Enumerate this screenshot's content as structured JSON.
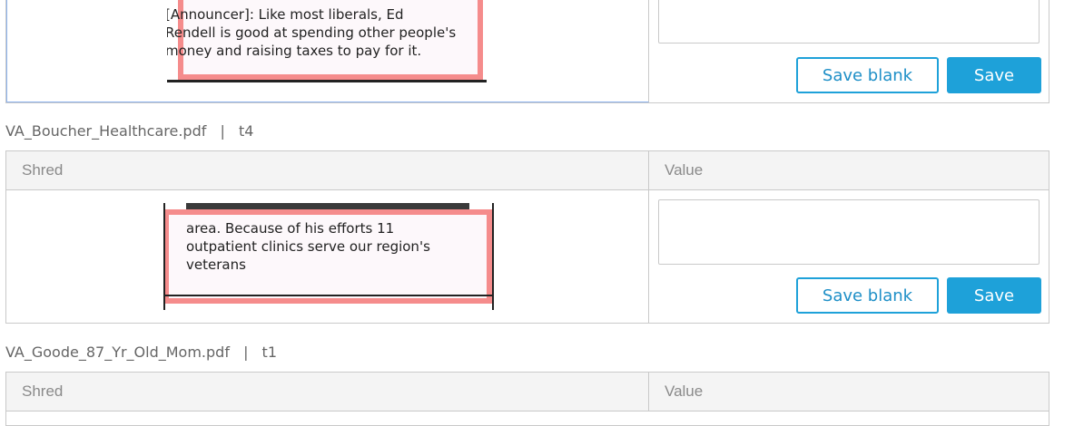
{
  "table": {
    "header": {
      "shred": "Shred",
      "value": "Value"
    }
  },
  "records": [
    {
      "shred_text": "[Announcer]: Like most liberals, Ed\nRendell is good at spending other people's\nmoney and raising taxes to pay for it.",
      "value": "",
      "save_blank_label": "Save blank",
      "save_label": "Save"
    },
    {
      "file": "VA_Boucher_Healthcare.pdf",
      "separator": "|",
      "tag": "t4",
      "shred_text": "area. Because of his efforts 11\noutpatient clinics serve our region's\nveterans",
      "value": "",
      "save_blank_label": "Save blank",
      "save_label": "Save"
    },
    {
      "file": "VA_Goode_87_Yr_Old_Mom.pdf",
      "separator": "|",
      "tag": "t1"
    }
  ],
  "colors": {
    "accent": "#1ea1d9",
    "highlight": "#f58c8c",
    "border": "#c9c9c9"
  }
}
